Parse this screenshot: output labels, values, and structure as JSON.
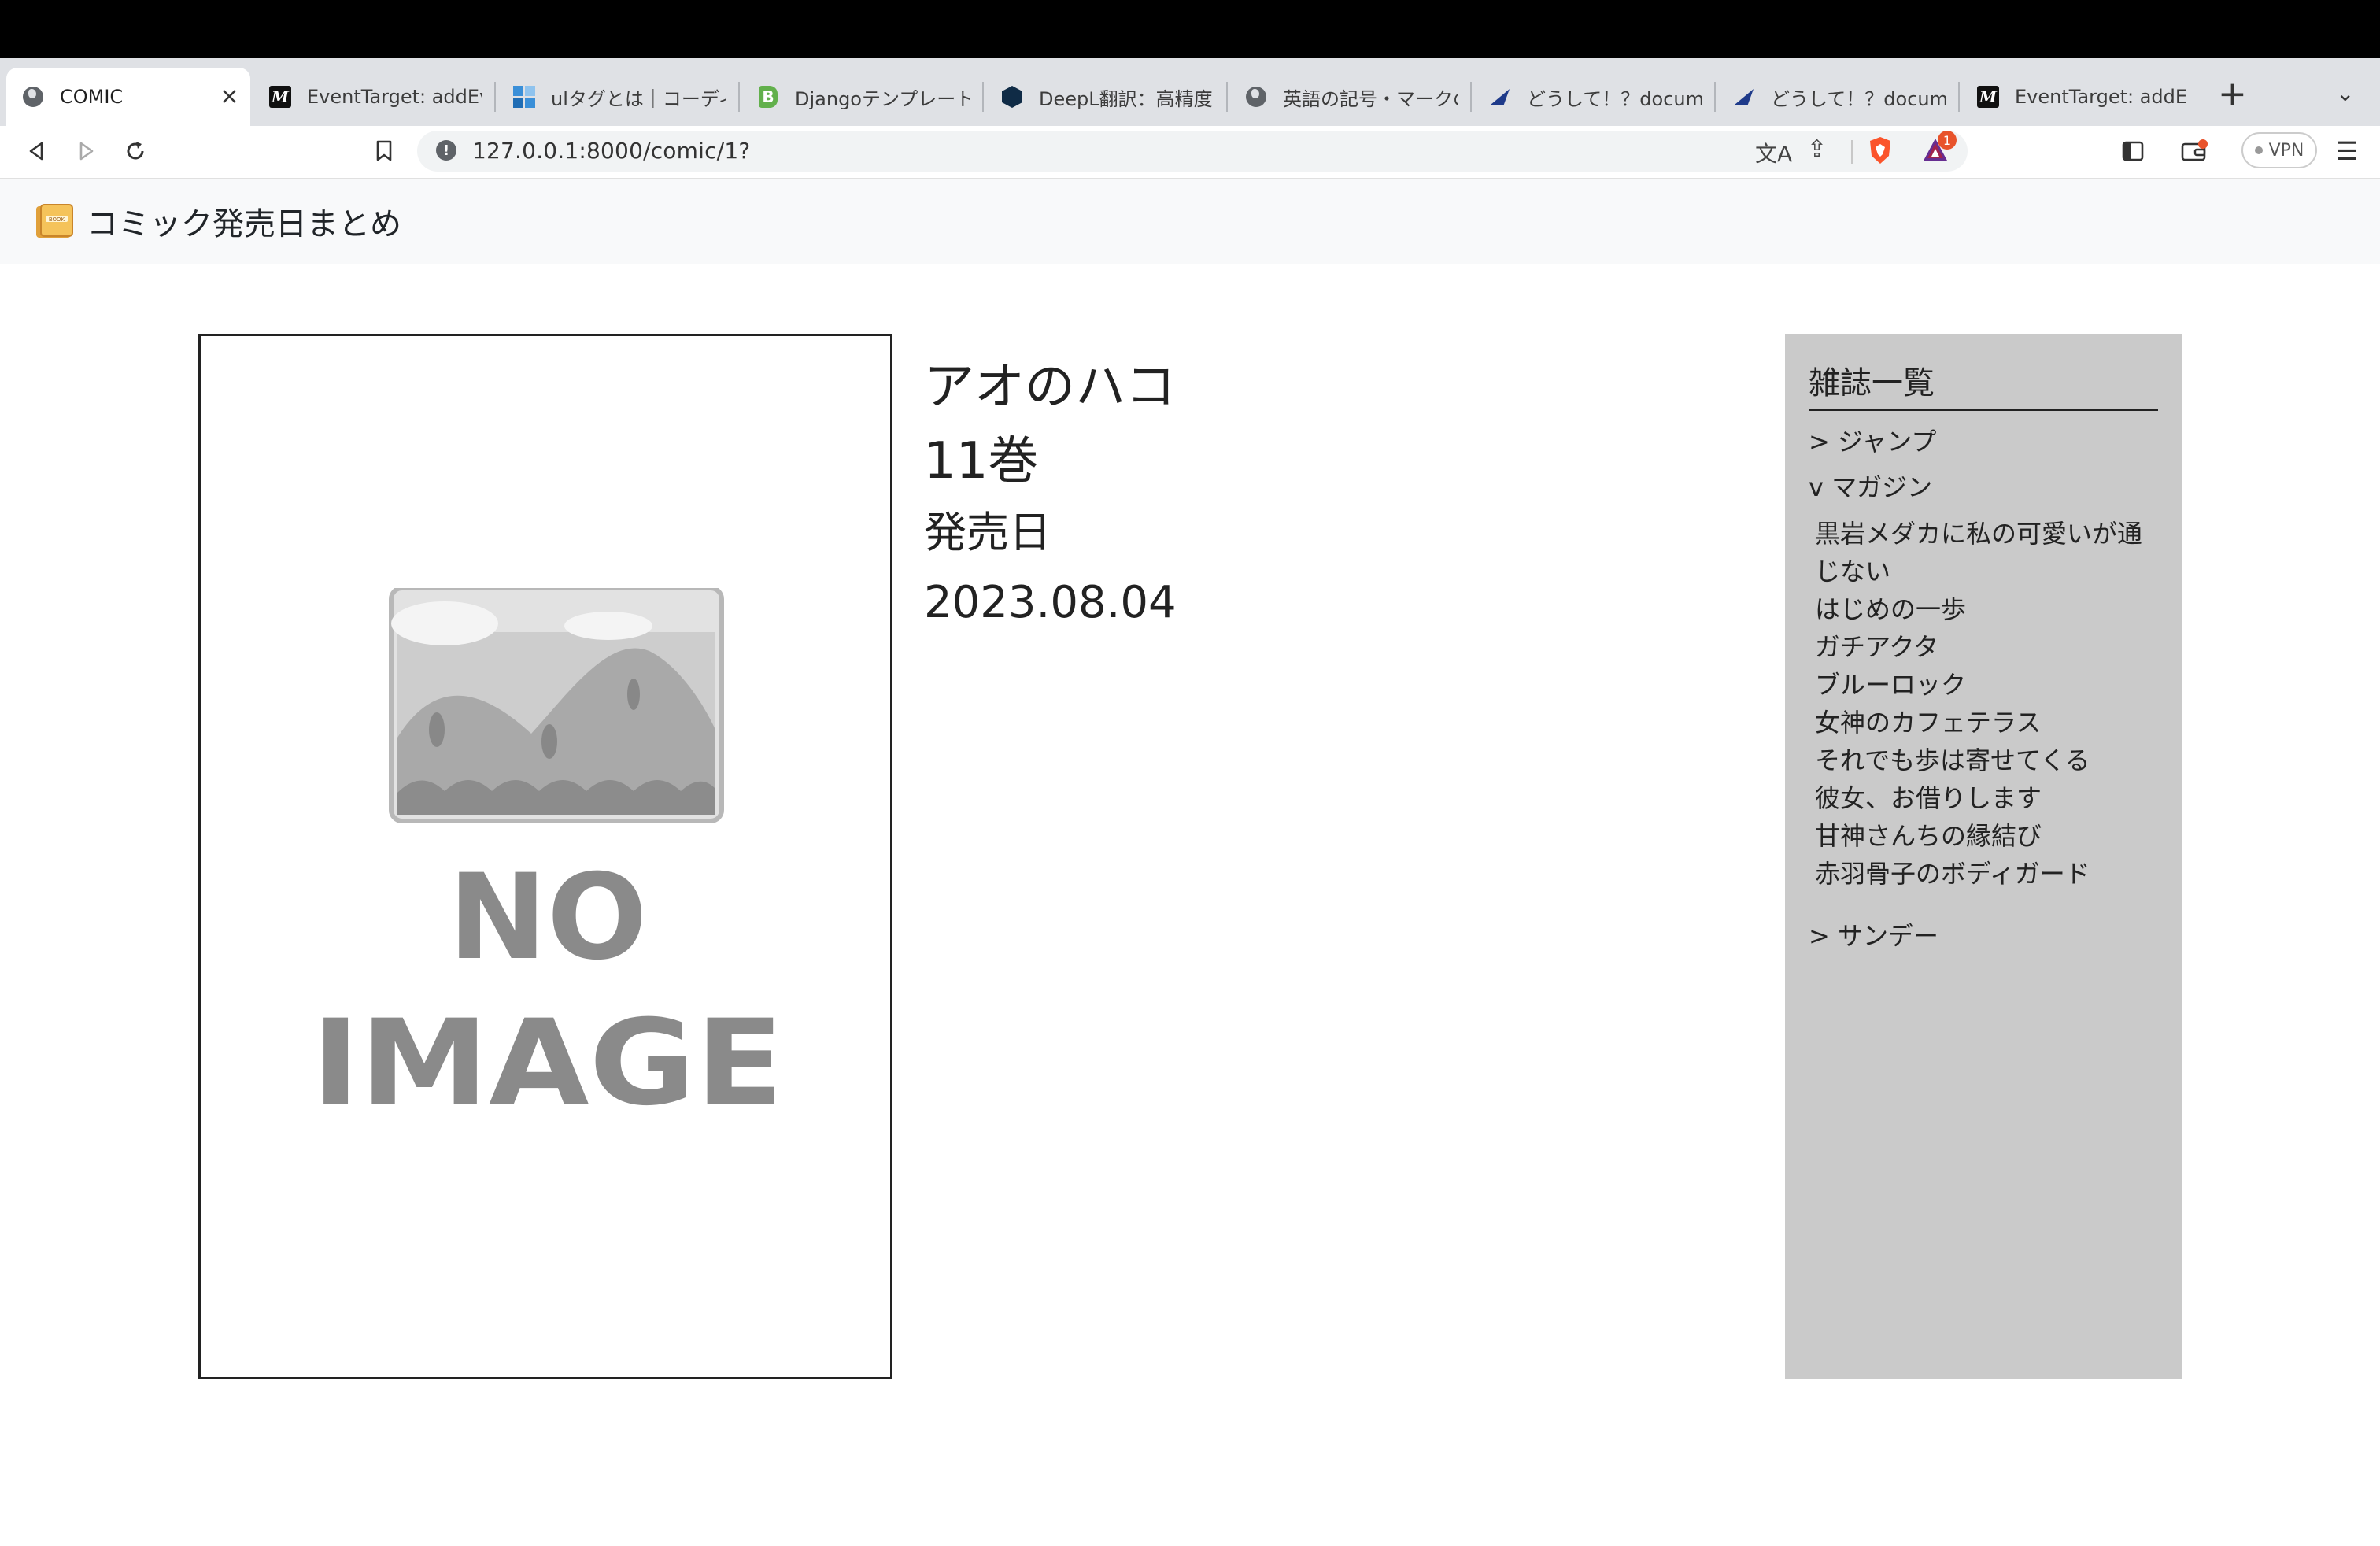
{
  "browser": {
    "tabs": [
      {
        "title": "COMIC",
        "icon": "globe-icon",
        "active": true
      },
      {
        "title": "EventTarget: addEventListener()",
        "icon": "mdn-icon"
      },
      {
        "title": "ulタグとは｜コーディング",
        "icon": "grid-icon"
      },
      {
        "title": "Djangoテンプレート内",
        "icon": "bootstrap-icon"
      },
      {
        "title": "DeepL翻訳：高精度な翻訳",
        "icon": "deepl-icon"
      },
      {
        "title": "英語の記号・マークの読み方",
        "icon": "globe-icon"
      },
      {
        "title": "どうして！？documentが",
        "icon": "plane-icon"
      },
      {
        "title": "どうして！？documentが",
        "icon": "plane-icon"
      },
      {
        "title": "EventTarget: addEventListener()",
        "icon": "mdn-icon"
      }
    ],
    "new_tab": "+",
    "tab_close": "×",
    "url": "127.0.0.1:8000/comic/1?",
    "rewards_count": "1",
    "vpn_label": "VPN"
  },
  "site": {
    "brand": "コミック発売日まとめ"
  },
  "comic": {
    "title": "アオのハコ",
    "volume": "11巻",
    "release_label": "発売日",
    "release_date": "2023.08.04",
    "cover_text_line1": "NO",
    "cover_text_line2": "IMAGE"
  },
  "sidebar": {
    "title": "雑誌一覧",
    "magazines": [
      {
        "label": "> ジャンプ"
      },
      {
        "label": "v マガジン"
      },
      {
        "label": "> サンデー"
      }
    ],
    "manga": [
      "黒岩メダカに私の可愛いが通じない",
      "はじめの一歩",
      "ガチアクタ",
      "ブルーロック",
      "女神のカフェテラス",
      "それでも歩は寄せてくる",
      "彼女、お借りします",
      "甘神さんちの縁結び",
      "赤羽骨子のボディガード"
    ]
  }
}
